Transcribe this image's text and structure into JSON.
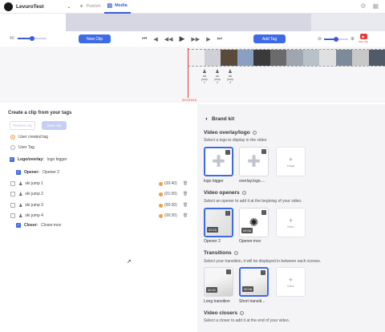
{
  "topbar": {
    "org_name": "LevuroTest",
    "tabs": [
      {
        "label": "Publish",
        "icon": "publish-icon"
      },
      {
        "label": "Media",
        "icon": "media-icon"
      }
    ],
    "right_icons": [
      "settings-icon",
      "grid-icon"
    ]
  },
  "controls": {
    "zoom_value": "40",
    "new_clip_label": "New Clip",
    "add_tag_label": "Add Tag",
    "zoom_level": 0.5,
    "youtube_label": "Play Clip"
  },
  "timeline": {
    "timecode": "00:03.616",
    "tag_markers": [
      {
        "label": "ski jump 1"
      },
      {
        "label": "ski jump 2"
      },
      {
        "label": "ski jump 3"
      }
    ],
    "frame_colors": [
      "#f0f0f0",
      "#cfd0d6",
      "#5a4a3a",
      "#8aa0c0",
      "#3a3a3a",
      "#6b6b6b",
      "#a0a6b0",
      "#b8c0c8",
      "#e0e0e0",
      "#7d8a9a",
      "#c8c8c8",
      "#505a68"
    ]
  },
  "left": {
    "title": "Create a clip from your tags",
    "preview_label": "Preview clip",
    "save_label": "Save clip",
    "radios": [
      {
        "label": "User created tag",
        "selected": true
      },
      {
        "label": "User Tag",
        "selected": false
      }
    ],
    "logo": {
      "label": "Logo/overlay:",
      "value": "logo bigger"
    },
    "opener": {
      "label": "Opener:",
      "value": "Opener 2"
    },
    "clips": [
      {
        "name": "ski jump 1",
        "duration": "(00:40)"
      },
      {
        "name": "ski jump 2",
        "duration": "(01:00)"
      },
      {
        "name": "ski jump 3",
        "duration": "(00:30)"
      },
      {
        "name": "ski jump 4",
        "duration": "(00:30)"
      }
    ],
    "closer": {
      "label": "Closer:",
      "value": "Closer.mov"
    }
  },
  "brand": {
    "title": "Brand kit",
    "sections": {
      "overlay": {
        "title": "Video overlay/logo",
        "desc": "Select a logo to display in the video",
        "items": [
          {
            "caption": "logo bigger",
            "selected": true
          },
          {
            "caption": "overlay.logo....",
            "selected": false
          }
        ],
        "add_label": "Image"
      },
      "openers": {
        "title": "Video openers",
        "desc": "Select an opener to add it at the begining of your video.",
        "items": [
          {
            "caption": "Opener 2",
            "duration": "00:16",
            "selected": true
          },
          {
            "caption": "Opener.mov",
            "duration": "00:06",
            "selected": false
          }
        ],
        "add_label": "Video"
      },
      "transitions": {
        "title": "Transitions",
        "desc": "Select your transition, it will be displayed in between each scenes.",
        "items": [
          {
            "caption": "Long transition",
            "duration": "00:31",
            "selected": false
          },
          {
            "caption": "Short transiti...",
            "duration": "00:06",
            "selected": true
          }
        ],
        "add_label": "Video"
      },
      "closers": {
        "title": "Video closers",
        "desc": "Select a closer to add it at the end of your video."
      }
    }
  }
}
